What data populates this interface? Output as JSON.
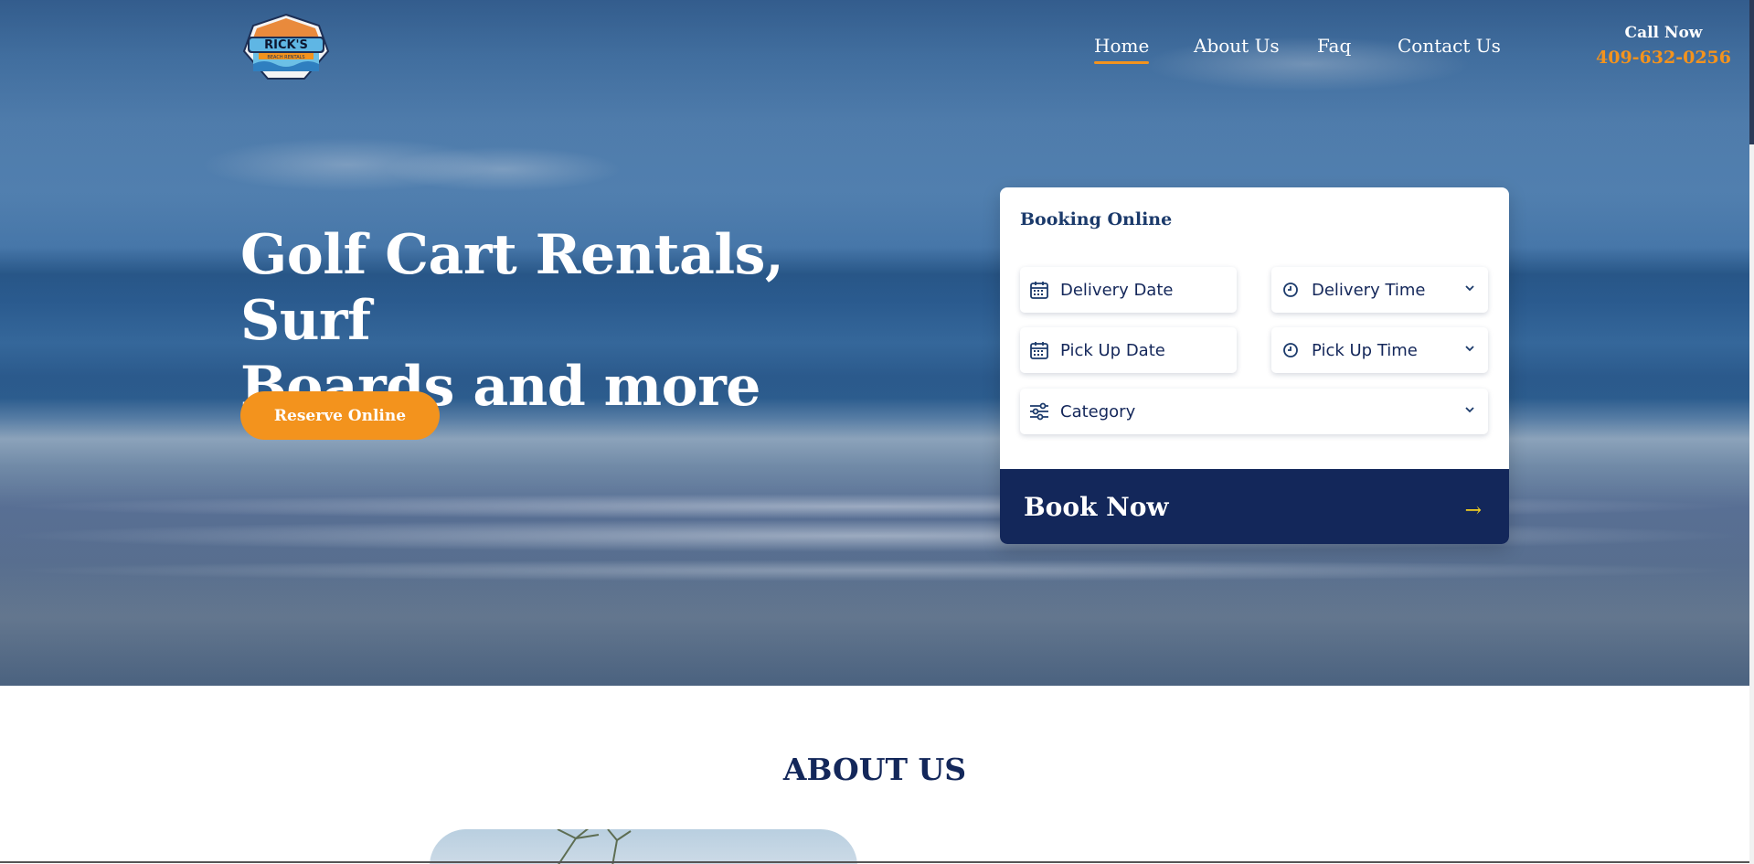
{
  "logo": {
    "text": "RICK'S",
    "subtext": "BEACH RENTALS"
  },
  "nav": {
    "items": [
      {
        "label": "Home",
        "active": true
      },
      {
        "label": "About Us",
        "active": false
      },
      {
        "label": "Faq",
        "active": false
      },
      {
        "label": "Contact Us",
        "active": false
      }
    ]
  },
  "call": {
    "label": "Call Now",
    "number": "409-632-0256"
  },
  "hero": {
    "title_line1": "Golf Cart Rentals, Surf",
    "title_line2": "Boards and more",
    "reserve_label": "Reserve Online"
  },
  "booking": {
    "title": "Booking Online",
    "delivery_date": "Delivery Date",
    "delivery_time": "Delivery Time",
    "pickup_date": "Pick Up Date",
    "pickup_time": "Pick Up Time",
    "category": "Category",
    "book_now": "Book Now",
    "arrow": "→"
  },
  "about": {
    "title": "ABOUT US"
  },
  "colors": {
    "accent": "#f3931d",
    "navy": "#13275a",
    "arrow": "#f4d020"
  }
}
